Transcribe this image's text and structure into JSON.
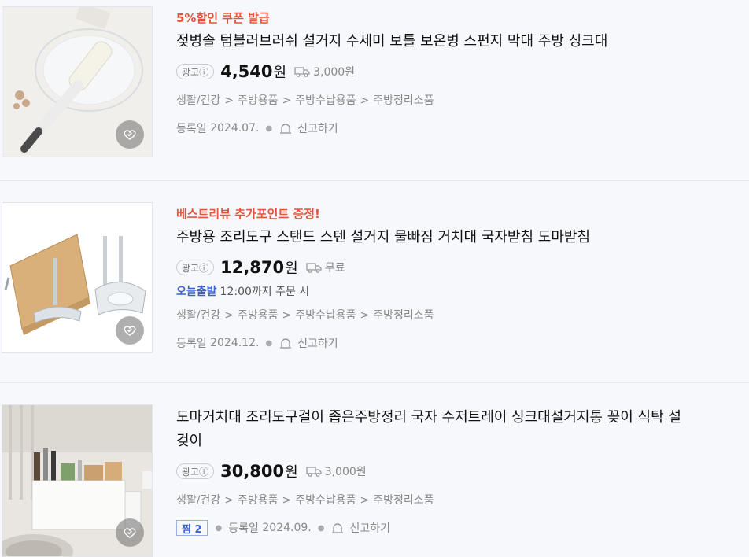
{
  "items": [
    {
      "promo": "5%할인 쿠폰 발급",
      "title": "젖병솔 텀블러브러쉬 설거지 수세미 보틀 보온병 스펀지 막대 주방 싱크대",
      "ad_label": "광고ⓘ",
      "price": "4,540",
      "currency": "원",
      "shipping": "3,000원",
      "category": [
        "생활/건강",
        "주방용품",
        "주방수납용품",
        "주방정리소품"
      ],
      "reg_label": "등록일",
      "reg_date": "2024.07.",
      "report_label": "신고하기"
    },
    {
      "promo": "베스트리뷰 추가포인트 증정!",
      "title": "주방용 조리도구 스탠드 스텐 설거지 물빠짐 거치대 국자받침 도마받침",
      "ad_label": "광고ⓘ",
      "price": "12,870",
      "currency": "원",
      "shipping": "무료",
      "today_label": "오늘출발",
      "today_text": "12:00까지 주문 시",
      "category": [
        "생활/건강",
        "주방용품",
        "주방수납용품",
        "주방정리소품"
      ],
      "reg_label": "등록일",
      "reg_date": "2024.12.",
      "report_label": "신고하기"
    },
    {
      "title_line1": "도마거치대 조리도구걸이 좁은주방정리 국자 수저트레이 싱크대설거지통 꽂이 식탁 설",
      "title_line2": "겆이",
      "ad_label": "광고ⓘ",
      "price": "30,800",
      "currency": "원",
      "shipping": "3,000원",
      "category": [
        "생활/건강",
        "주방용품",
        "주방수납용품",
        "주방정리소품"
      ],
      "zzim_label": "찜 2",
      "reg_label": "등록일",
      "reg_date": "2024.09.",
      "report_label": "신고하기"
    }
  ],
  "category_separator": ">",
  "colors": {
    "promo": "#e2553d",
    "today": "#3b62d4",
    "meta": "#888888"
  },
  "icons": {
    "shipping": "truck-icon",
    "report": "siren-icon",
    "wishlist": "heart-check-icon"
  }
}
